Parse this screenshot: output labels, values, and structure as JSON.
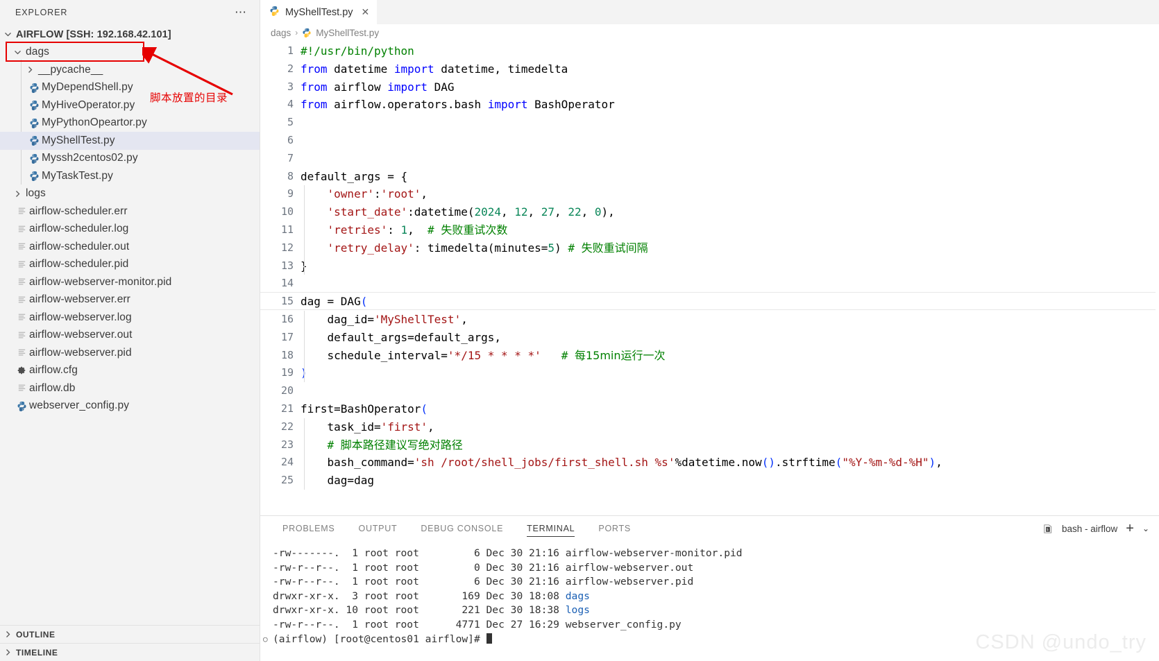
{
  "sidebar": {
    "title": "EXPLORER",
    "more_icon": "ellipsis-icon",
    "root": {
      "label": "AIRFLOW [SSH: 192.168.42.101]",
      "expanded": true
    },
    "items": [
      {
        "label": "dags",
        "type": "folder",
        "level": 1,
        "expanded": true,
        "icon": "chevron-down-icon",
        "highlight": true
      },
      {
        "label": "__pycache__",
        "type": "folder",
        "level": 2,
        "expanded": false,
        "icon": "chevron-right-icon"
      },
      {
        "label": "MyDependShell.py",
        "type": "python",
        "level": 2,
        "icon": "python-icon"
      },
      {
        "label": "MyHiveOperator.py",
        "type": "python",
        "level": 2,
        "icon": "python-icon"
      },
      {
        "label": "MyPythonOpeartor.py",
        "type": "python",
        "level": 2,
        "icon": "python-icon"
      },
      {
        "label": "MyShellTest.py",
        "type": "python",
        "level": 2,
        "icon": "python-icon",
        "selected": true
      },
      {
        "label": "Myssh2centos02.py",
        "type": "python",
        "level": 2,
        "icon": "python-icon"
      },
      {
        "label": "MyTaskTest.py",
        "type": "python",
        "level": 2,
        "icon": "python-icon"
      },
      {
        "label": "logs",
        "type": "folder",
        "level": 1,
        "expanded": false,
        "icon": "chevron-right-icon"
      },
      {
        "label": "airflow-scheduler.err",
        "type": "file",
        "level": 1,
        "icon": "text-file-icon"
      },
      {
        "label": "airflow-scheduler.log",
        "type": "file",
        "level": 1,
        "icon": "text-file-icon"
      },
      {
        "label": "airflow-scheduler.out",
        "type": "file",
        "level": 1,
        "icon": "text-file-icon"
      },
      {
        "label": "airflow-scheduler.pid",
        "type": "file",
        "level": 1,
        "icon": "text-file-icon"
      },
      {
        "label": "airflow-webserver-monitor.pid",
        "type": "file",
        "level": 1,
        "icon": "text-file-icon"
      },
      {
        "label": "airflow-webserver.err",
        "type": "file",
        "level": 1,
        "icon": "text-file-icon"
      },
      {
        "label": "airflow-webserver.log",
        "type": "file",
        "level": 1,
        "icon": "text-file-icon"
      },
      {
        "label": "airflow-webserver.out",
        "type": "file",
        "level": 1,
        "icon": "text-file-icon"
      },
      {
        "label": "airflow-webserver.pid",
        "type": "file",
        "level": 1,
        "icon": "text-file-icon"
      },
      {
        "label": "airflow.cfg",
        "type": "config",
        "level": 1,
        "icon": "gear-icon"
      },
      {
        "label": "airflow.db",
        "type": "file",
        "level": 1,
        "icon": "text-file-icon"
      },
      {
        "label": "webserver_config.py",
        "type": "python",
        "level": 1,
        "icon": "python-icon"
      }
    ],
    "sections": [
      {
        "label": "OUTLINE",
        "expanded": false,
        "icon": "chevron-right-icon"
      },
      {
        "label": "TIMELINE",
        "expanded": false,
        "icon": "chevron-right-icon"
      }
    ]
  },
  "annotation": {
    "text": "脚本放置的目录",
    "color": "#e60000",
    "target": "dags"
  },
  "editor": {
    "tabs": [
      {
        "label": "MyShellTest.py",
        "icon": "python-icon",
        "active": true,
        "close_icon": "close-icon"
      }
    ],
    "breadcrumb": [
      {
        "label": "dags",
        "icon": null
      },
      {
        "label": "MyShellTest.py",
        "icon": "python-icon"
      }
    ],
    "first_line_number": 1,
    "lines": [
      {
        "n": 1,
        "tokens": [
          {
            "t": "#!/usr/bin/python",
            "c": "t-cmt"
          }
        ]
      },
      {
        "n": 2,
        "tokens": [
          {
            "t": "from",
            "c": "t-kw"
          },
          {
            "t": " datetime ",
            "c": "t-txt"
          },
          {
            "t": "import",
            "c": "t-kw"
          },
          {
            "t": " datetime, timedelta",
            "c": "t-txt"
          }
        ]
      },
      {
        "n": 3,
        "tokens": [
          {
            "t": "from",
            "c": "t-kw"
          },
          {
            "t": " airflow ",
            "c": "t-txt"
          },
          {
            "t": "import",
            "c": "t-kw"
          },
          {
            "t": " DAG",
            "c": "t-txt"
          }
        ]
      },
      {
        "n": 4,
        "tokens": [
          {
            "t": "from",
            "c": "t-kw"
          },
          {
            "t": " airflow.operators.bash ",
            "c": "t-txt"
          },
          {
            "t": "import",
            "c": "t-kw"
          },
          {
            "t": " BashOperator",
            "c": "t-txt"
          }
        ]
      },
      {
        "n": 5,
        "tokens": []
      },
      {
        "n": 6,
        "tokens": []
      },
      {
        "n": 7,
        "tokens": []
      },
      {
        "n": 8,
        "tokens": [
          {
            "t": "default_args = {",
            "c": "t-txt"
          }
        ]
      },
      {
        "n": 9,
        "tokens": [
          {
            "t": "    ",
            "c": "t-txt"
          },
          {
            "t": "'owner'",
            "c": "t-str"
          },
          {
            "t": ":",
            "c": "t-txt"
          },
          {
            "t": "'root'",
            "c": "t-str"
          },
          {
            "t": ",",
            "c": "t-txt"
          }
        ]
      },
      {
        "n": 10,
        "tokens": [
          {
            "t": "    ",
            "c": "t-txt"
          },
          {
            "t": "'start_date'",
            "c": "t-str"
          },
          {
            "t": ":datetime(",
            "c": "t-txt"
          },
          {
            "t": "2024",
            "c": "t-num"
          },
          {
            "t": ", ",
            "c": "t-txt"
          },
          {
            "t": "12",
            "c": "t-num"
          },
          {
            "t": ", ",
            "c": "t-txt"
          },
          {
            "t": "27",
            "c": "t-num"
          },
          {
            "t": ", ",
            "c": "t-txt"
          },
          {
            "t": "22",
            "c": "t-num"
          },
          {
            "t": ", ",
            "c": "t-txt"
          },
          {
            "t": "0",
            "c": "t-num"
          },
          {
            "t": "),",
            "c": "t-txt"
          }
        ]
      },
      {
        "n": 11,
        "tokens": [
          {
            "t": "    ",
            "c": "t-txt"
          },
          {
            "t": "'retries'",
            "c": "t-str"
          },
          {
            "t": ": ",
            "c": "t-txt"
          },
          {
            "t": "1",
            "c": "t-num"
          },
          {
            "t": ",  ",
            "c": "t-txt"
          },
          {
            "t": "# ",
            "c": "t-cmt"
          },
          {
            "t": "失败重试次数",
            "c": "t-cmtz"
          }
        ]
      },
      {
        "n": 12,
        "tokens": [
          {
            "t": "    ",
            "c": "t-txt"
          },
          {
            "t": "'retry_delay'",
            "c": "t-str"
          },
          {
            "t": ": timedelta(minutes=",
            "c": "t-txt"
          },
          {
            "t": "5",
            "c": "t-num"
          },
          {
            "t": ") ",
            "c": "t-txt"
          },
          {
            "t": "# ",
            "c": "t-cmt"
          },
          {
            "t": "失败重试间隔",
            "c": "t-cmtz"
          }
        ]
      },
      {
        "n": 13,
        "tokens": [
          {
            "t": "}",
            "c": "t-txt"
          }
        ]
      },
      {
        "n": 14,
        "tokens": []
      },
      {
        "n": 15,
        "tokens": [
          {
            "t": "dag = DAG",
            "c": "t-txt"
          },
          {
            "t": "(",
            "c": "t-par"
          }
        ],
        "current": true
      },
      {
        "n": 16,
        "tokens": [
          {
            "t": "    dag_id=",
            "c": "t-txt"
          },
          {
            "t": "'MyShellTest'",
            "c": "t-str"
          },
          {
            "t": ",",
            "c": "t-txt"
          }
        ]
      },
      {
        "n": 17,
        "tokens": [
          {
            "t": "    default_args=default_args,",
            "c": "t-txt"
          }
        ]
      },
      {
        "n": 18,
        "tokens": [
          {
            "t": "    schedule_interval=",
            "c": "t-txt"
          },
          {
            "t": "'*/15 * * * *'",
            "c": "t-str"
          },
          {
            "t": "   ",
            "c": "t-txt"
          },
          {
            "t": "# ",
            "c": "t-cmt"
          },
          {
            "t": "每15min运行一次",
            "c": "t-cmtz"
          }
        ]
      },
      {
        "n": 19,
        "tokens": [
          {
            "t": ")",
            "c": "t-par"
          }
        ]
      },
      {
        "n": 20,
        "tokens": []
      },
      {
        "n": 21,
        "tokens": [
          {
            "t": "first=BashOperator",
            "c": "t-txt"
          },
          {
            "t": "(",
            "c": "t-par"
          }
        ]
      },
      {
        "n": 22,
        "tokens": [
          {
            "t": "    task_id=",
            "c": "t-txt"
          },
          {
            "t": "'first'",
            "c": "t-str"
          },
          {
            "t": ",",
            "c": "t-txt"
          }
        ]
      },
      {
        "n": 23,
        "tokens": [
          {
            "t": "    ",
            "c": "t-txt"
          },
          {
            "t": "# ",
            "c": "t-cmt"
          },
          {
            "t": "脚本路径建议写绝对路径",
            "c": "t-cmtz"
          }
        ]
      },
      {
        "n": 24,
        "tokens": [
          {
            "t": "    bash_command=",
            "c": "t-txt"
          },
          {
            "t": "'sh /root/shell_jobs/first_shell.sh %s'",
            "c": "t-str"
          },
          {
            "t": "%datetime.now",
            "c": "t-txt"
          },
          {
            "t": "(",
            "c": "t-par"
          },
          {
            "t": ")",
            "c": "t-par"
          },
          {
            "t": ".strftime",
            "c": "t-txt"
          },
          {
            "t": "(",
            "c": "t-par"
          },
          {
            "t": "\"%Y-%m-%d-%H\"",
            "c": "t-str"
          },
          {
            "t": ")",
            "c": "t-par"
          },
          {
            "t": ",",
            "c": "t-txt"
          }
        ]
      },
      {
        "n": 25,
        "tokens": [
          {
            "t": "    dag=dag",
            "c": "t-txt"
          }
        ]
      }
    ]
  },
  "panel": {
    "tabs": [
      {
        "label": "PROBLEMS",
        "active": false
      },
      {
        "label": "OUTPUT",
        "active": false
      },
      {
        "label": "DEBUG CONSOLE",
        "active": false
      },
      {
        "label": "TERMINAL",
        "active": true
      },
      {
        "label": "PORTS",
        "active": false
      }
    ],
    "terminal_name": "bash - airflow",
    "terminal_icon": "terminal-shell-icon",
    "add_icon": "plus-icon",
    "split_icon": "chevron-down-icon",
    "lines": [
      {
        "perm": "-rw-------.",
        "links": "1",
        "owner": "root",
        "group": "root",
        "size": "6",
        "date": "Dec 30 21:16",
        "name": "airflow-webserver-monitor.pid",
        "is_dir": false
      },
      {
        "perm": "-rw-r--r--.",
        "links": "1",
        "owner": "root",
        "group": "root",
        "size": "0",
        "date": "Dec 30 21:16",
        "name": "airflow-webserver.out",
        "is_dir": false
      },
      {
        "perm": "-rw-r--r--.",
        "links": "1",
        "owner": "root",
        "group": "root",
        "size": "6",
        "date": "Dec 30 21:16",
        "name": "airflow-webserver.pid",
        "is_dir": false
      },
      {
        "perm": "drwxr-xr-x.",
        "links": "3",
        "owner": "root",
        "group": "root",
        "size": "169",
        "date": "Dec 30 18:08",
        "name": "dags",
        "is_dir": true
      },
      {
        "perm": "drwxr-xr-x.",
        "links": "10",
        "owner": "root",
        "group": "root",
        "size": "221",
        "date": "Dec 30 18:38",
        "name": "logs",
        "is_dir": true
      },
      {
        "perm": "-rw-r--r--.",
        "links": "1",
        "owner": "root",
        "group": "root",
        "size": "4771",
        "date": "Dec 27 16:29",
        "name": "webserver_config.py",
        "is_dir": false
      }
    ],
    "prompt": "(airflow) [root@centos01 airflow]#"
  },
  "watermark": "CSDN @undo_try",
  "colors": {
    "accent_red": "#e60000",
    "sidebar_bg": "#f3f3f3",
    "selection": "#e4e6f1",
    "python_icon": "#386e9d",
    "terminal_dir": "#1a5fb4"
  }
}
